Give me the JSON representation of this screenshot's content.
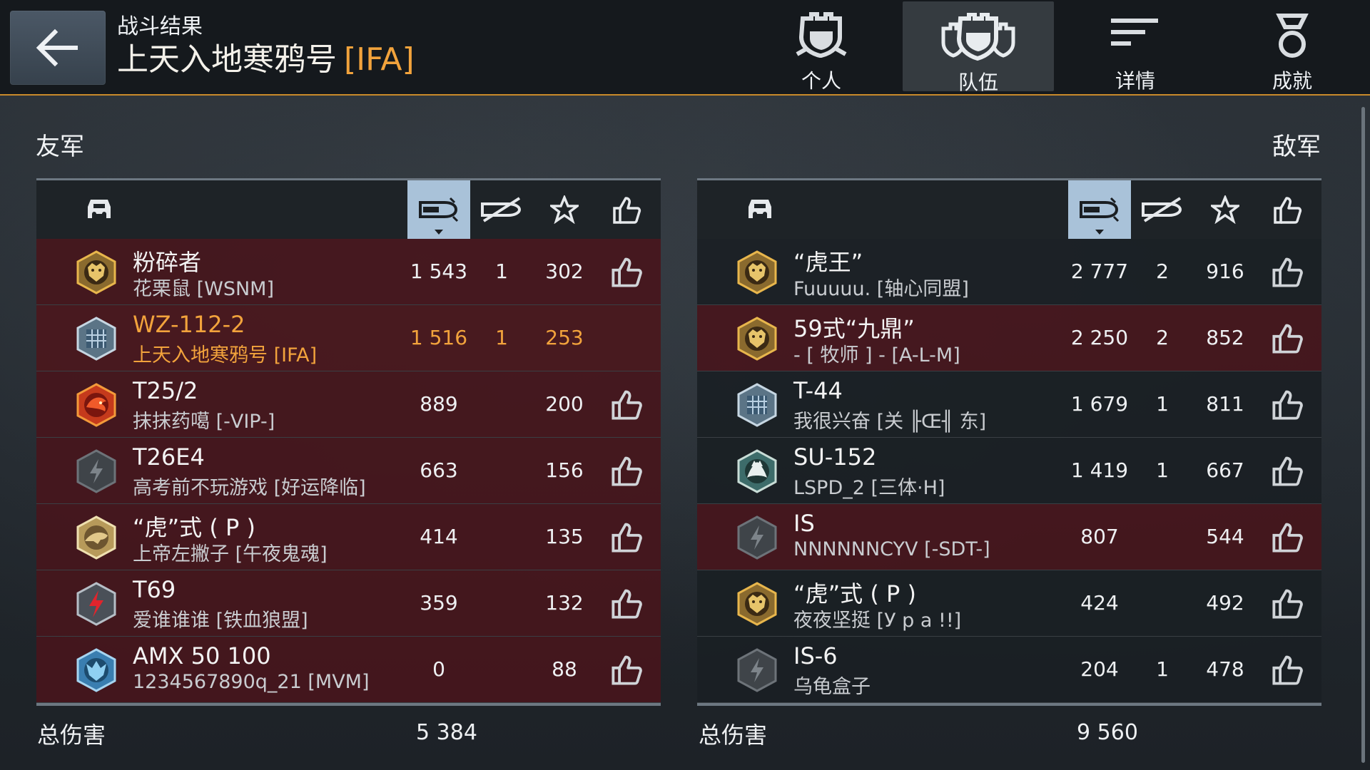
{
  "header": {
    "subtitle": "战斗结果",
    "map_name": "上天入地寒鸦号",
    "clan_tag": "[IFA]",
    "tabs": [
      {
        "label": "个人",
        "icon": "helmet-icon",
        "active": false
      },
      {
        "label": "队伍",
        "icon": "team-helmets-icon",
        "active": true
      },
      {
        "label": "详情",
        "icon": "details-lines-icon",
        "active": false
      },
      {
        "label": "成就",
        "icon": "medal-icon",
        "active": false
      }
    ]
  },
  "allies": {
    "heading": "友军",
    "total_label": "总伤害",
    "total_damage": "5 384",
    "rows": [
      {
        "tank": "粉碎者",
        "player": "花栗鼠 [WSNM]",
        "damage": "1 543",
        "kills": "1",
        "score": "302",
        "badge": "gold-tiger-badge",
        "style": "red",
        "like": true
      },
      {
        "tank": "WZ-112-2",
        "player": "上天入地寒鸦号 [IFA]",
        "damage": "1 516",
        "kills": "1",
        "score": "253",
        "badge": "silver-grid-badge",
        "style": "self",
        "like": false
      },
      {
        "tank": "T25/2",
        "player": "抹抹药噶 [-VIP-]",
        "damage": "889",
        "kills": "",
        "score": "200",
        "badge": "red-dragon-badge",
        "style": "red",
        "like": true
      },
      {
        "tank": "T26E4",
        "player": "高考前不玩游戏 [好运降临]",
        "damage": "663",
        "kills": "",
        "score": "156",
        "badge": "grey-lightning-badge",
        "style": "red",
        "like": true
      },
      {
        "tank": "“虎”式 ( P )",
        "player": "上帝左撇子 [午夜鬼魂]",
        "damage": "414",
        "kills": "",
        "score": "135",
        "badge": "tan-creature-badge",
        "style": "red",
        "like": true
      },
      {
        "tank": "T69",
        "player": "爱谁谁谁 [铁血狼盟]",
        "damage": "359",
        "kills": "",
        "score": "132",
        "badge": "red-lightning-badge",
        "style": "red",
        "like": true
      },
      {
        "tank": "AMX 50 100",
        "player": "1234567890q_21 [MVM]",
        "damage": "0",
        "kills": "",
        "score": "88",
        "badge": "blue-wolf-badge",
        "style": "red",
        "like": true
      }
    ]
  },
  "enemies": {
    "heading": "敌军",
    "total_label": "总伤害",
    "total_damage": "9 560",
    "rows": [
      {
        "tank": "“虎王”",
        "player": "Fuuuuu. [轴心同盟]",
        "damage": "2 777",
        "kills": "2",
        "score": "916",
        "badge": "gold-tiger-badge",
        "style": "dark",
        "like": true
      },
      {
        "tank": "59式“九鼎”",
        "player": "- [ 牧师 ] - [A-L-M]",
        "damage": "2 250",
        "kills": "2",
        "score": "852",
        "badge": "gold-tiger-badge",
        "style": "red",
        "like": true
      },
      {
        "tank": "T-44",
        "player": "我很兴奋 [关 ╟Œ╢ 东]",
        "damage": "1 679",
        "kills": "1",
        "score": "811",
        "badge": "silver-grid-badge",
        "style": "dark",
        "like": true
      },
      {
        "tank": "SU-152",
        "player": "LSPD_2 [三体·H]",
        "damage": "1 419",
        "kills": "1",
        "score": "667",
        "badge": "teal-wolf-badge",
        "style": "dark",
        "like": true
      },
      {
        "tank": "IS",
        "player": "NNNNNNCYV [-SDT-]",
        "damage": "807",
        "kills": "",
        "score": "544",
        "badge": "grey-lightning-badge",
        "style": "red",
        "like": true
      },
      {
        "tank": "“虎”式 ( P )",
        "player": "夜夜坚挺 [У р а !!]",
        "damage": "424",
        "kills": "",
        "score": "492",
        "badge": "gold-tiger-badge",
        "style": "dark",
        "like": true
      },
      {
        "tank": "IS-6",
        "player": "乌龟盒子",
        "damage": "204",
        "kills": "1",
        "score": "478",
        "badge": "grey-lightning-badge",
        "style": "dark",
        "like": true
      }
    ]
  },
  "columns": [
    {
      "icon": "tank-icon"
    },
    {
      "icon": "damage-shell-icon",
      "sorted": true
    },
    {
      "icon": "kills-crossed-icon"
    },
    {
      "icon": "star-icon"
    },
    {
      "icon": "thumbs-up-icon"
    }
  ],
  "colors": {
    "accent": "#f2a33c",
    "sorted_column": "#a9c2d9",
    "ally_row": "#46161c",
    "enemy_row_dark": "#1a1f24",
    "divider": "#c98a2a"
  }
}
